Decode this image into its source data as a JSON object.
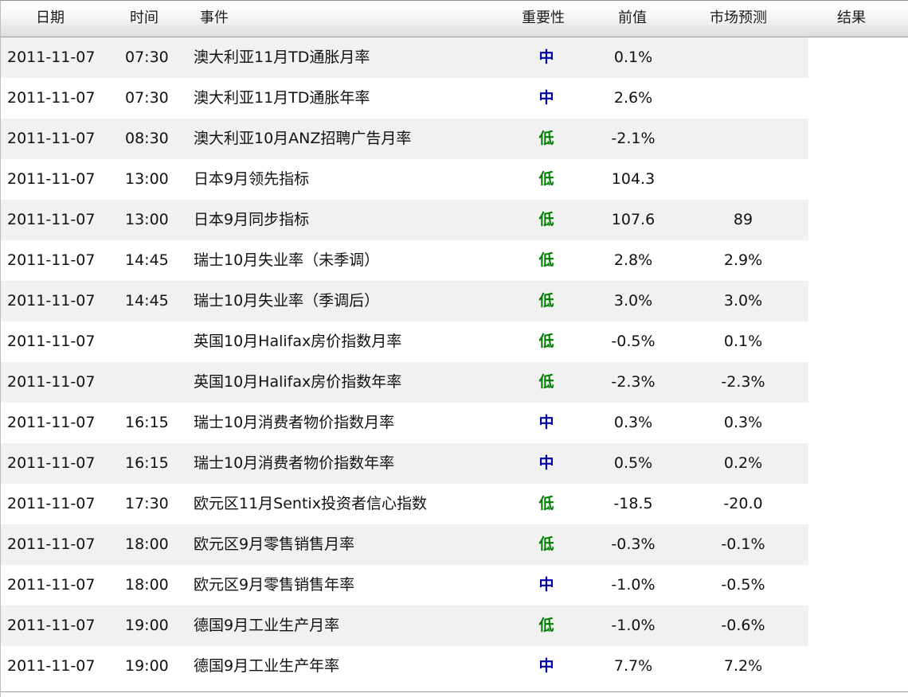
{
  "header": {
    "date": "日期",
    "time": "时间",
    "event": "事件",
    "importance": "重要性",
    "previous": "前值",
    "forecast": "市场预测",
    "result": "结果"
  },
  "colors": {
    "importance_mid": "#0000a8",
    "importance_low": "#008000",
    "row_alt": "#f1f1f1"
  },
  "rows": [
    {
      "date": "2011-11-07",
      "time": "07:30",
      "event": "澳大利亚11月TD通胀月率",
      "importance": "中",
      "previous": "0.1%",
      "forecast": "",
      "result": ""
    },
    {
      "date": "2011-11-07",
      "time": "07:30",
      "event": "澳大利亚11月TD通胀年率",
      "importance": "中",
      "previous": "2.6%",
      "forecast": "",
      "result": ""
    },
    {
      "date": "2011-11-07",
      "time": "08:30",
      "event": "澳大利亚10月ANZ招聘广告月率",
      "importance": "低",
      "previous": "-2.1%",
      "forecast": "",
      "result": ""
    },
    {
      "date": "2011-11-07",
      "time": "13:00",
      "event": "日本9月领先指标",
      "importance": "低",
      "previous": "104.3",
      "forecast": "",
      "result": ""
    },
    {
      "date": "2011-11-07",
      "time": "13:00",
      "event": "日本9月同步指标",
      "importance": "低",
      "previous": "107.6",
      "forecast": "89",
      "result": ""
    },
    {
      "date": "2011-11-07",
      "time": "14:45",
      "event": "瑞士10月失业率（未季调）",
      "importance": "低",
      "previous": "2.8%",
      "forecast": "2.9%",
      "result": ""
    },
    {
      "date": "2011-11-07",
      "time": "14:45",
      "event": "瑞士10月失业率（季调后）",
      "importance": "低",
      "previous": "3.0%",
      "forecast": "3.0%",
      "result": ""
    },
    {
      "date": "2011-11-07",
      "time": "",
      "event": "英国10月Halifax房价指数月率",
      "importance": "低",
      "previous": "-0.5%",
      "forecast": "0.1%",
      "result": ""
    },
    {
      "date": "2011-11-07",
      "time": "",
      "event": "英国10月Halifax房价指数年率",
      "importance": "低",
      "previous": "-2.3%",
      "forecast": "-2.3%",
      "result": ""
    },
    {
      "date": "2011-11-07",
      "time": "16:15",
      "event": "瑞士10月消费者物价指数月率",
      "importance": "中",
      "previous": "0.3%",
      "forecast": "0.3%",
      "result": ""
    },
    {
      "date": "2011-11-07",
      "time": "16:15",
      "event": "瑞士10月消费者物价指数年率",
      "importance": "中",
      "previous": "0.5%",
      "forecast": "0.2%",
      "result": ""
    },
    {
      "date": "2011-11-07",
      "time": "17:30",
      "event": "欧元区11月Sentix投资者信心指数",
      "importance": "低",
      "previous": "-18.5",
      "forecast": "-20.0",
      "result": ""
    },
    {
      "date": "2011-11-07",
      "time": "18:00",
      "event": "欧元区9月零售销售月率",
      "importance": "低",
      "previous": "-0.3%",
      "forecast": "-0.1%",
      "result": ""
    },
    {
      "date": "2011-11-07",
      "time": "18:00",
      "event": "欧元区9月零售销售年率",
      "importance": "中",
      "previous": "-1.0%",
      "forecast": "-0.5%",
      "result": ""
    },
    {
      "date": "2011-11-07",
      "time": "19:00",
      "event": "德国9月工业生产月率",
      "importance": "低",
      "previous": "-1.0%",
      "forecast": "-0.6%",
      "result": ""
    },
    {
      "date": "2011-11-07",
      "time": "19:00",
      "event": "德国9月工业生产年率",
      "importance": "中",
      "previous": "7.7%",
      "forecast": "7.2%",
      "result": ""
    }
  ]
}
